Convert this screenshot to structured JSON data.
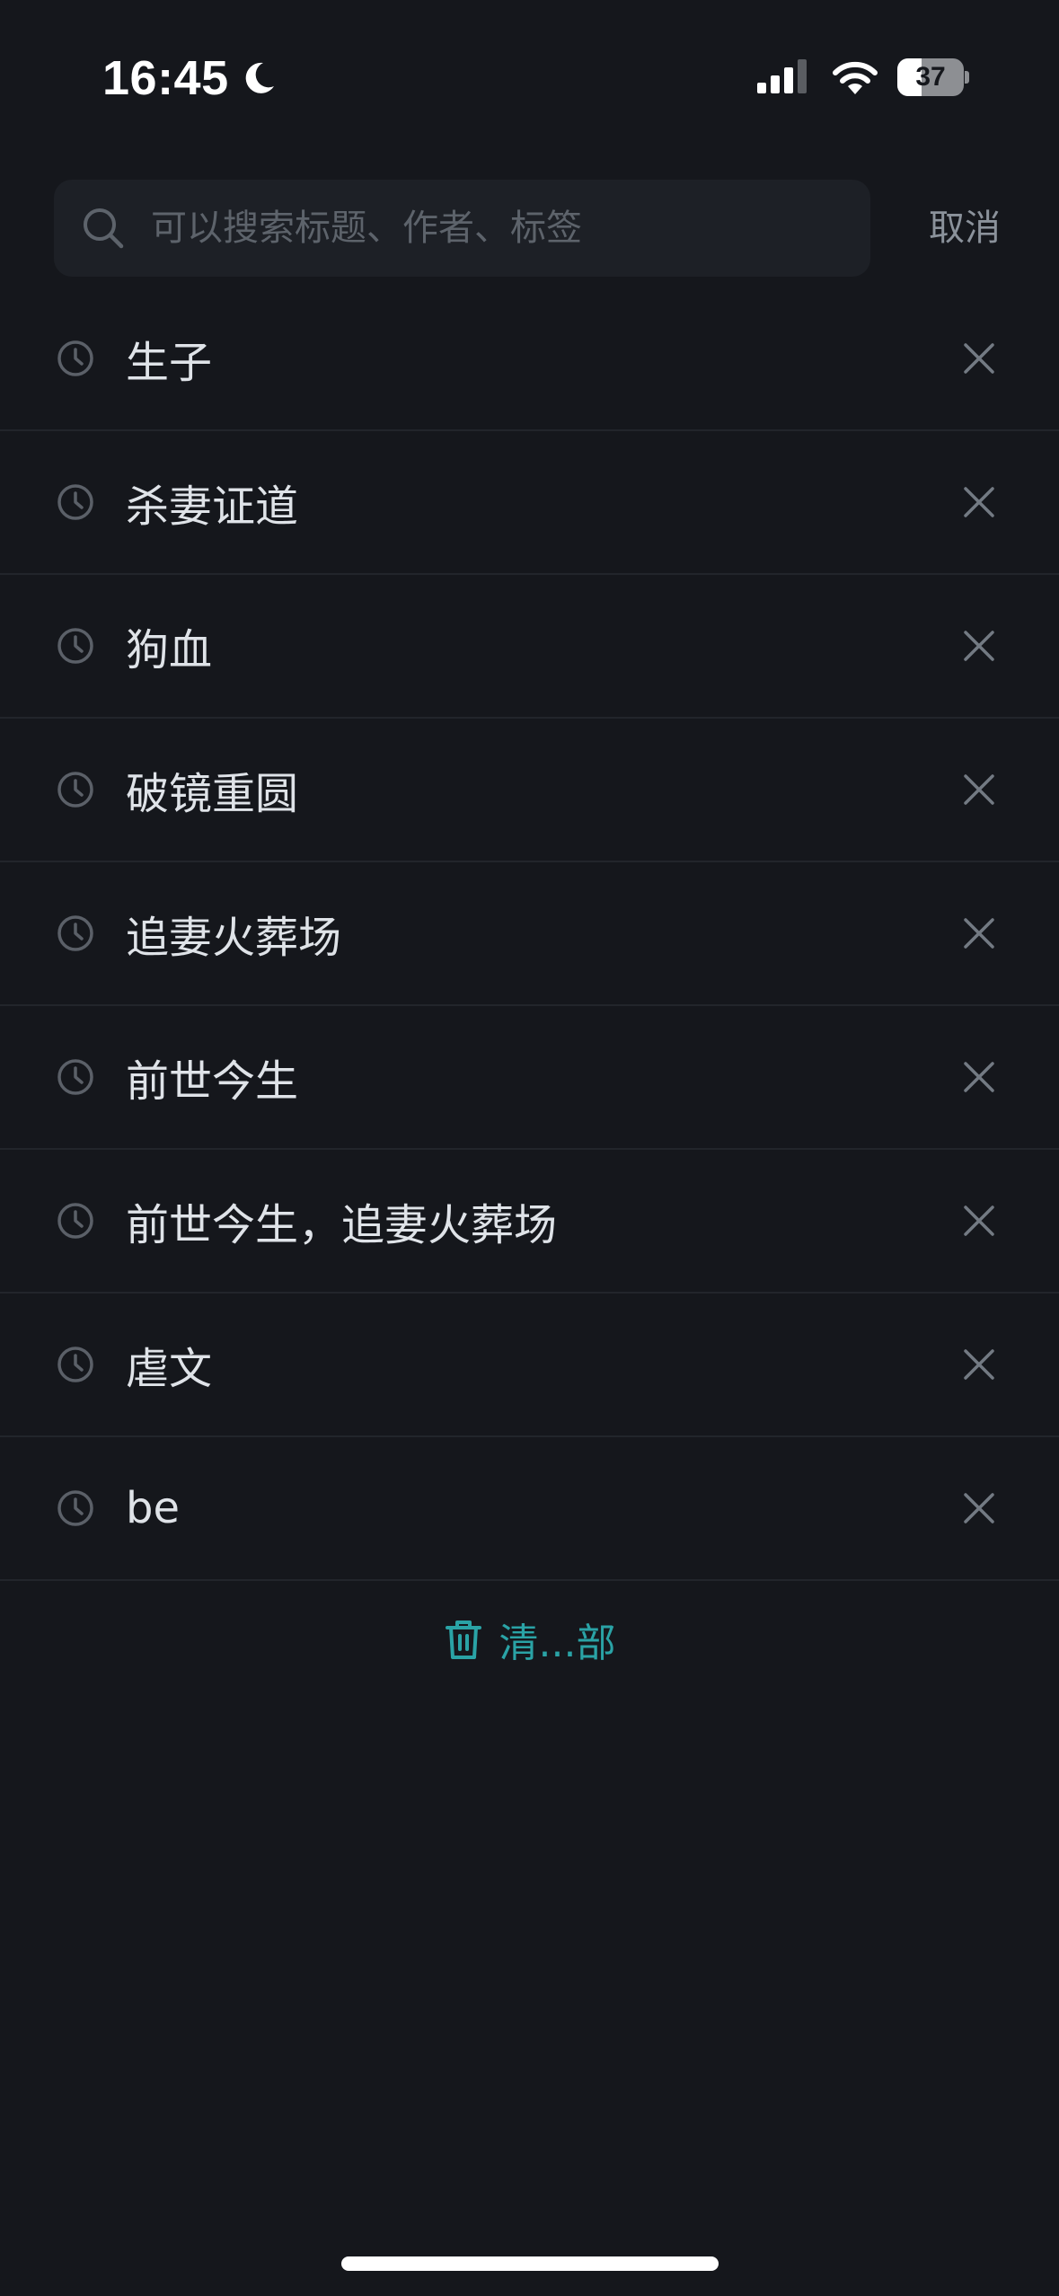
{
  "status_bar": {
    "time": "16:45",
    "battery_level": "37",
    "battery_fraction": 0.37,
    "icons": [
      "moon-icon",
      "signal-icon",
      "wifi-icon",
      "battery-icon"
    ]
  },
  "search": {
    "placeholder": "可以搜索标题、作者、标签",
    "value": "",
    "cancel_label": "取消",
    "icon": "search-icon"
  },
  "history": {
    "item_icon": "clock-icon",
    "remove_icon": "close-icon",
    "items": [
      {
        "label": "生子"
      },
      {
        "label": "杀妻证道"
      },
      {
        "label": "狗血"
      },
      {
        "label": "破镜重圆"
      },
      {
        "label": "追妻火葬场"
      },
      {
        "label": "前世今生"
      },
      {
        "label": "前世今生，追妻火葬场"
      },
      {
        "label": "虐文"
      },
      {
        "label": "be"
      }
    ]
  },
  "clear_all": {
    "label": "清...部",
    "icon": "trash-icon",
    "color": "#2aa3a6"
  },
  "colors": {
    "background": "#15171c",
    "search_bg": "#1d2026",
    "text": "#dfe3e8",
    "muted": "#8b929b",
    "accent": "#2aa3a6"
  }
}
